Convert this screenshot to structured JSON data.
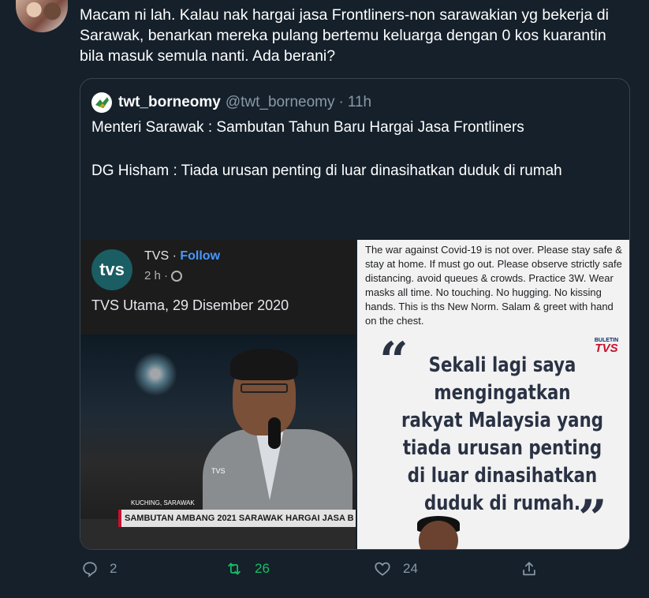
{
  "tweet": {
    "text": "Macam ni lah. Kalau nak hargai jasa Frontliners-non sarawakian yg bekerja di Sarawak, benarkan mereka pulang bertemu keluarga dengan 0 kos kuarantin bila masuk semula nanti. Ada berani?"
  },
  "quote": {
    "name": "twt_borneomy",
    "handle": "@twt_borneomy",
    "separator": "·",
    "time": "11h",
    "line1": "Menteri Sarawak : Sambutan Tahun Baru Hargai Jasa Frontliners",
    "line2": "DG Hisham : Tiada urusan penting di luar dinasihatkan duduk di rumah",
    "emoji_icons": [
      "woman-facepalming-icon",
      "woman-facepalming-icon",
      "woman-facepalming-icon",
      "woman-facepalming-icon"
    ]
  },
  "media_left": {
    "logo": "tvs",
    "page_name": "TVS",
    "dot": "·",
    "follow": "Follow",
    "time": "2 h ·",
    "caption": "TVS Utama, 29 Disember 2020",
    "location": "KUCHING, SARAWAK",
    "ticker": "SAMBUTAN AMBANG 2021 SARAWAK HARGAI JASA B",
    "mic_brand": "TVS"
  },
  "media_right": {
    "notice": "The war against Covid-19 is not over. Please stay safe & stay at home. If must go out. Please observe strictly safe distancing. avoid queues & crowds. Practice 3W. Wear masks all time. No touching. No hugging. No kissing hands. This is ths New Norm. Salam & greet with hand on the chest.",
    "bulletin_top": "BULETIN",
    "bulletin_brand": "TVS",
    "open_quote": "“",
    "close_quote": "”",
    "quote_lines": [
      "Sekali lagi saya",
      "mengingatkan",
      "rakyat Malaysia yang",
      "tiada urusan penting",
      "di luar dinasihatkan",
      "duduk di rumah."
    ]
  },
  "actions": {
    "reply_count": "2",
    "retweet_count": "26",
    "like_count": "24",
    "colors": {
      "muted": "#8899a6",
      "retweet_active": "#17bf63"
    }
  },
  "colors": {
    "background": "#15202b",
    "border": "#38444d",
    "follow": "#4599ff"
  }
}
